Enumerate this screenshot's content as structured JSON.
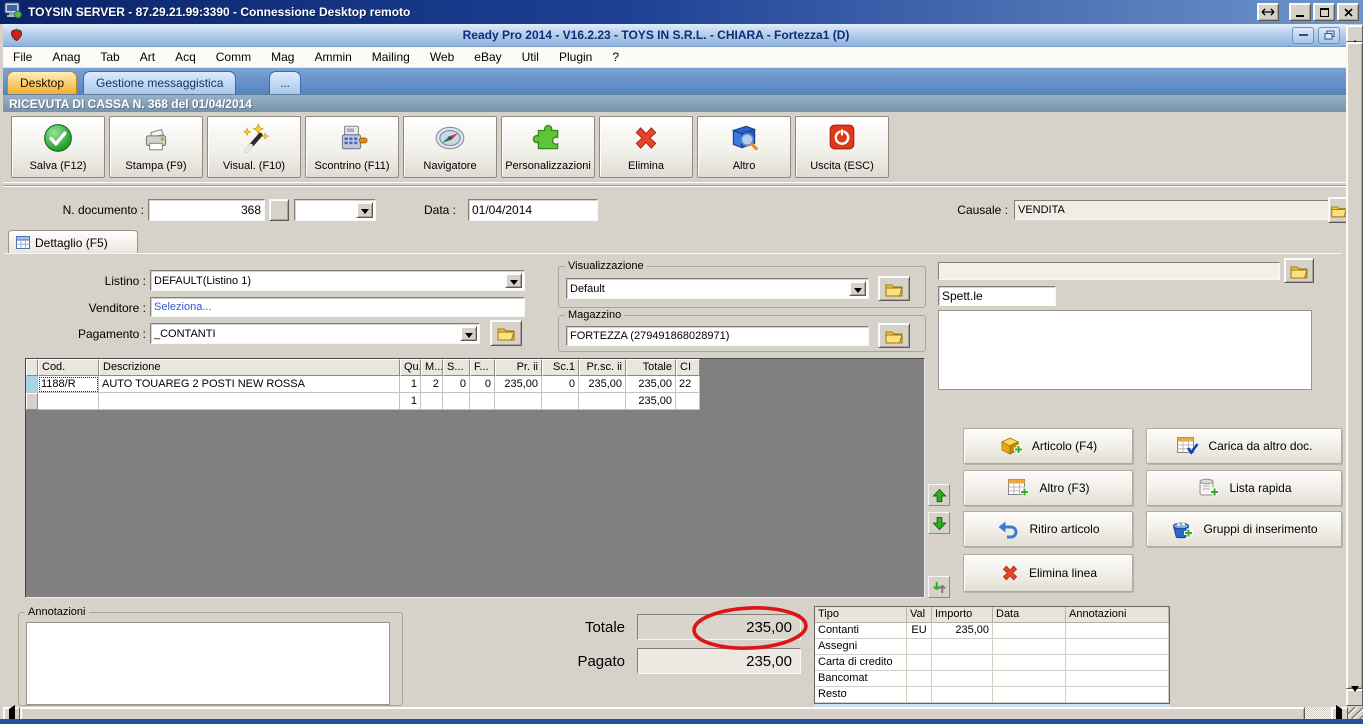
{
  "colors": {
    "rdp_title_blue": "#0a246a",
    "app_title_text": "#0b2d7a",
    "active_tab_orange": "#f5ad2e",
    "tabbar_blue": "#5584c0",
    "doc_header_bluegray": "#7e9ab2",
    "annotation_red": "#dd1515",
    "seleziona_link_blue": "#3a56c8"
  },
  "rdp": {
    "title": "TOYSIN SERVER - 87.29.21.99:3390 - Connessione Desktop remoto"
  },
  "app": {
    "title": "Ready Pro 2014 - V16.2.23 - TOYS IN S.R.L. - CHIARA - Fortezza1 (D)",
    "menu": [
      "File",
      "Anag",
      "Tab",
      "Art",
      "Acq",
      "Comm",
      "Mag",
      "Ammin",
      "Mailing",
      "Web",
      "eBay",
      "Util",
      "Plugin",
      "?"
    ],
    "tabs": {
      "desktop": "Desktop",
      "gestione": "Gestione messaggistica",
      "more": "..."
    },
    "doc_header": "RICEVUTA DI CASSA N. 368 del 01/04/2014"
  },
  "toolbar": {
    "buttons": [
      {
        "label": "Salva (F12)"
      },
      {
        "label": "Stampa (F9)"
      },
      {
        "label": "Visual. (F10)"
      },
      {
        "label": "Scontrino (F11)"
      },
      {
        "label": "Navigatore"
      },
      {
        "label": "Personalizzazioni"
      },
      {
        "label": "Elimina"
      },
      {
        "label": "Altro"
      },
      {
        "label": "Uscita (ESC)"
      }
    ]
  },
  "document": {
    "n_label": "N. documento :",
    "numero": "368",
    "data_label": "Data :",
    "data": "01/04/2014",
    "causale_label": "Causale :",
    "causale": "VENDITA"
  },
  "detail": {
    "tab": "Dettaglio (F5)",
    "listino_label": "Listino :",
    "listino": "DEFAULT(Listino 1)",
    "venditore_label": "Venditore :",
    "venditore": "Seleziona...",
    "pagamento_label": "Pagamento :",
    "pagamento": "_CONTANTI",
    "visualizzazione_label": "Visualizzazione",
    "visualizzazione": "Default",
    "magazzino_label": "Magazzino",
    "magazzino": "FORTEZZA (279491868028971)",
    "destinatario": "Spett.le"
  },
  "grid": {
    "columns": [
      "Cod.",
      "Descrizione",
      "Qu.",
      "M...",
      "S...",
      "F...",
      "Pr. ii",
      "Sc.1",
      "Pr.sc. ii",
      "Totale",
      "CI"
    ],
    "rows": [
      {
        "cod": "1188/R",
        "descrizione": "AUTO TOUAREG 2 POSTI NEW ROSSA",
        "qu": "1",
        "m": "2",
        "s": "0",
        "f": "0",
        "pr_ii": "235,00",
        "sc1": "0",
        "pr_sc_ii": "235,00",
        "totale": "235,00",
        "ci": "22"
      }
    ],
    "totals": {
      "qu": "1",
      "totale": "235,00"
    }
  },
  "actions": {
    "articolo": "Articolo (F4)",
    "carica": "Carica da altro doc.",
    "altro": "Altro (F3)",
    "lista": "Lista rapida",
    "ritiro": "Ritiro articolo",
    "gruppi": "Gruppi di inserimento",
    "elimina_linea": "Elimina linea"
  },
  "footer": {
    "annotazioni_label": "Annotazioni",
    "totale_label": "Totale",
    "totale": "235,00",
    "pagato_label": "Pagato",
    "pagato": "235,00",
    "payments": {
      "columns": [
        "Tipo",
        "Val",
        "Importo",
        "Data",
        "Annotazioni"
      ],
      "rows": [
        {
          "tipo": "Contanti",
          "val": "EU",
          "importo": "235,00",
          "data": "",
          "annotazioni": ""
        },
        {
          "tipo": "Assegni",
          "val": "",
          "importo": "",
          "data": "",
          "annotazioni": ""
        },
        {
          "tipo": "Carta di credito",
          "val": "",
          "importo": "",
          "data": "",
          "annotazioni": ""
        },
        {
          "tipo": "Bancomat",
          "val": "",
          "importo": "",
          "data": "",
          "annotazioni": ""
        },
        {
          "tipo": "Resto",
          "val": "",
          "importo": "",
          "data": "",
          "annotazioni": ""
        }
      ]
    }
  }
}
